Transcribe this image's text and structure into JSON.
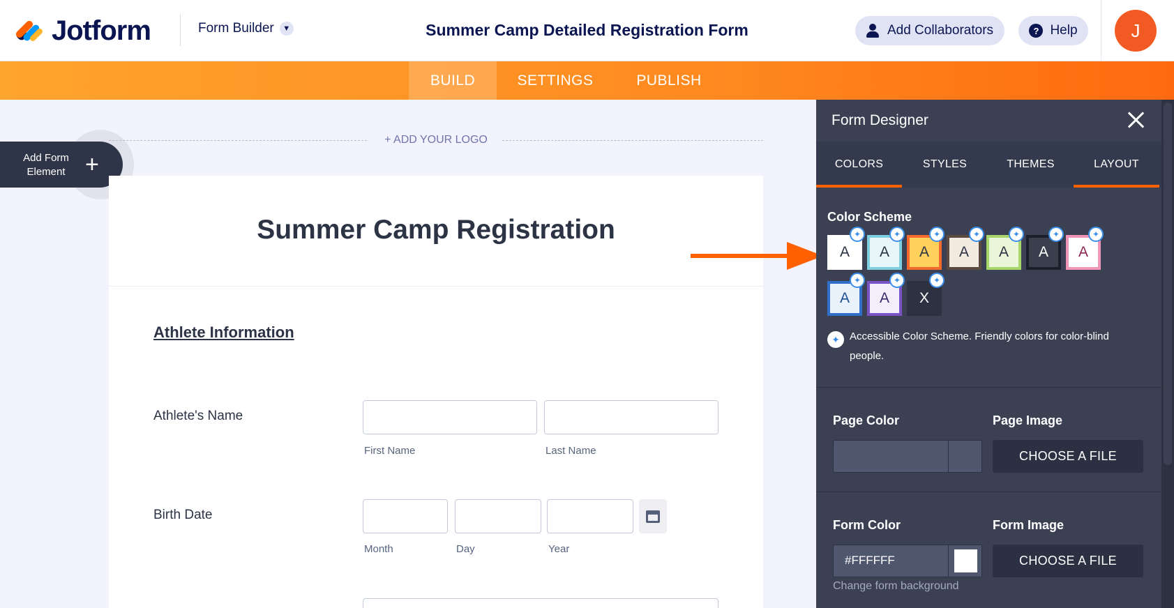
{
  "header": {
    "brand": "Jotform",
    "form_builder_label": "Form Builder",
    "form_title": "Summer Camp Detailed Registration Form",
    "add_collaborators_label": "Add Collaborators",
    "help_label": "Help",
    "help_glyph": "?",
    "avatar_initial": "J"
  },
  "nav": {
    "tabs": [
      {
        "label": "BUILD",
        "active": true
      },
      {
        "label": "SETTINGS",
        "active": false
      },
      {
        "label": "PUBLISH",
        "active": false
      }
    ]
  },
  "canvas": {
    "add_element_label": "Add Form Element",
    "add_element_glyph": "+",
    "add_logo_label": "+ ADD YOUR LOGO",
    "form_heading": "Summer Camp Registration",
    "section_title": "Athlete Information",
    "fields": [
      {
        "label": "Athlete's Name",
        "sublabels": [
          "First Name",
          "Last Name"
        ]
      },
      {
        "label": "Birth Date",
        "sublabels": [
          "Month",
          "Day",
          "Year"
        ]
      }
    ]
  },
  "designer": {
    "title": "Form Designer",
    "tabs": [
      {
        "label": "COLORS",
        "selected": true
      },
      {
        "label": "STYLES",
        "selected": false
      },
      {
        "label": "THEMES",
        "selected": false
      },
      {
        "label": "LAYOUT",
        "selected": true
      }
    ],
    "color_scheme_title": "Color Scheme",
    "swatches": [
      {
        "glyph": "A",
        "bg": "#ffffff",
        "border": "#ffffff",
        "fg": "#2c3345"
      },
      {
        "glyph": "A",
        "bg": "#e8f6f9",
        "border": "#7fd0de",
        "fg": "#2c3345"
      },
      {
        "glyph": "A",
        "bg": "#ffd15c",
        "border": "#f36a2e",
        "fg": "#2c3345"
      },
      {
        "glyph": "A",
        "bg": "#f3ebe0",
        "border": "#5a4a3f",
        "fg": "#2c3345"
      },
      {
        "glyph": "A",
        "bg": "#eaf6d8",
        "border": "#a7d66a",
        "fg": "#2c3345"
      },
      {
        "glyph": "A",
        "bg": "#3a3f4e",
        "border": "#1b1f2b",
        "fg": "#ffffff"
      },
      {
        "glyph": "A",
        "bg": "#ffffff",
        "border": "#f195b8",
        "fg": "#8c2854"
      },
      {
        "glyph": "A",
        "bg": "#e9f1fb",
        "border": "#2f6fc8",
        "fg": "#1d4f97"
      },
      {
        "glyph": "A",
        "bg": "#f3effa",
        "border": "#7a52c2",
        "fg": "#3d2a6e"
      },
      {
        "glyph": "X",
        "bg": "#2c3242",
        "border": "#2c3242",
        "fg": "#ffffff"
      }
    ],
    "accessible_badge_glyph": "✦",
    "accessible_note": "Accessible Color Scheme. Friendly colors for color-blind people.",
    "page_color_label": "Page Color",
    "page_color_value": "",
    "page_image_label": "Page Image",
    "choose_file_label": "CHOOSE A FILE",
    "form_color_label": "Form Color",
    "form_color_value": "#FFFFFF",
    "form_image_label": "Form Image",
    "form_color_helper": "Change form background"
  },
  "colors": {
    "accent": "#ff6100",
    "navy": "#0a1551",
    "panel_bg": "#3b4153"
  }
}
